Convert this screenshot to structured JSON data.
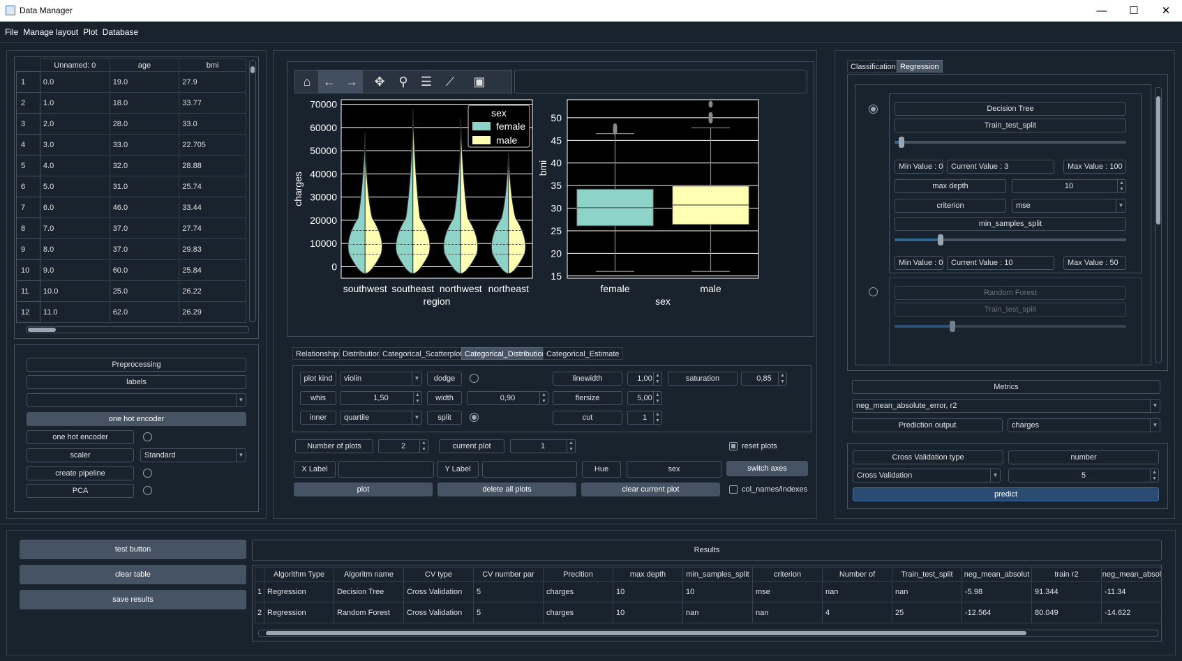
{
  "window": {
    "title": "Data Manager",
    "min": "—",
    "max": "☐",
    "close": "✕"
  },
  "menu": [
    "File",
    "Manage layout",
    "Plot",
    "Database"
  ],
  "data_table": {
    "columns": [
      "Unnamed: 0",
      "age",
      "bmi"
    ],
    "rows": [
      [
        "1",
        "0.0",
        "19.0",
        "27.9"
      ],
      [
        "2",
        "1.0",
        "18.0",
        "33.77"
      ],
      [
        "3",
        "2.0",
        "28.0",
        "33.0"
      ],
      [
        "4",
        "3.0",
        "33.0",
        "22.705"
      ],
      [
        "5",
        "4.0",
        "32.0",
        "28.88"
      ],
      [
        "6",
        "5.0",
        "31.0",
        "25.74"
      ],
      [
        "7",
        "6.0",
        "46.0",
        "33.44"
      ],
      [
        "8",
        "7.0",
        "37.0",
        "27.74"
      ],
      [
        "9",
        "8.0",
        "37.0",
        "29.83"
      ],
      [
        "10",
        "9.0",
        "60.0",
        "25.84"
      ],
      [
        "11",
        "10.0",
        "25.0",
        "26.22"
      ],
      [
        "12",
        "11.0",
        "62.0",
        "26.29"
      ]
    ]
  },
  "preprocessing": {
    "title": "Preprocessing",
    "labels": "labels",
    "combo_value": "",
    "ohe_button": "one hot encoder",
    "ohe_label": "one hot encoder",
    "scaler_label": "scaler",
    "scaler_value": "Standard",
    "pipeline_label": "create pipeline",
    "pca_label": "PCA"
  },
  "toolbar": {
    "icons": [
      "home-icon",
      "back-icon",
      "forward-icon",
      "pan-icon",
      "zoom-icon",
      "configure-icon",
      "edit-axes-icon",
      "save-icon"
    ],
    "coords": ""
  },
  "chart_data": [
    {
      "type": "violin",
      "x_categories": [
        "southwest",
        "southeast",
        "northwest",
        "northeast"
      ],
      "xlabel": "region",
      "ylabel": "charges",
      "yticks": [
        0,
        10000,
        20000,
        30000,
        40000,
        50000,
        60000,
        70000
      ],
      "ylim": [
        -5000,
        72000
      ],
      "legend": {
        "title": "sex",
        "entries": [
          "female",
          "male"
        ],
        "placement": "top-right"
      },
      "series": [
        {
          "name": "female",
          "color": "#8dd3c7",
          "max": [
            58000,
            62000,
            56000,
            49000
          ]
        },
        {
          "name": "male",
          "color": "#ffffb3",
          "max": [
            52000,
            68000,
            64000,
            49000
          ]
        }
      ],
      "inner": "quartile",
      "split": true,
      "grid": true
    },
    {
      "type": "box",
      "categories": [
        "female",
        "male"
      ],
      "xlabel": "sex",
      "ylabel": "bmi",
      "yticks": [
        15,
        20,
        25,
        30,
        35,
        40,
        45,
        50
      ],
      "ylim": [
        14.5,
        54
      ],
      "boxes": [
        {
          "name": "female",
          "color": "#8dd3c7",
          "min": 16,
          "q1": 26.1,
          "median": 30.1,
          "q3": 34.2,
          "max": 46.5,
          "outliers": [
            47,
            47.5,
            48
          ]
        },
        {
          "name": "male",
          "color": "#ffffb3",
          "min": 16,
          "q1": 26.4,
          "median": 30.7,
          "q3": 34.9,
          "max": 47.8,
          "outliers": [
            49.5,
            50.5,
            53
          ]
        }
      ],
      "grid": true
    }
  ],
  "plot_tabs": [
    "Relationships",
    "Distribution",
    "Categorical_Scatterplots",
    "Categorical_Distribution",
    "Categorical_Estimate"
  ],
  "plot_opts": {
    "plot_kind_l": "plot kind",
    "plot_kind": "violin",
    "dodge": "dodge",
    "linewidth_l": "linewidth",
    "linewidth": "1,00",
    "saturation_l": "saturation",
    "saturation": "0,85",
    "whis_l": "whis",
    "whis": "1,50",
    "width_l": "width",
    "width": "0,90",
    "fliersize_l": "flersize",
    "fliersize": "5,00",
    "inner_l": "inner",
    "inner": "quartile",
    "split": "split",
    "cut_l": "cut",
    "cut": "1"
  },
  "plot_ctrl": {
    "num_plots_l": "Number of plots",
    "num_plots": "2",
    "cur_plot_l": "current plot",
    "cur_plot": "1",
    "reset": "reset plots",
    "xlabel_l": "X Label",
    "xlabel": "",
    "ylabel_l": "Y Label",
    "ylabel": "",
    "hue_l": "Hue",
    "hue": "sex",
    "switch": "switch axes",
    "plot": "plot",
    "delete": "delete all plots",
    "clear": "clear current plot",
    "colnames": "col_names/indexes"
  },
  "model_tabs": [
    "Classification",
    "Regression"
  ],
  "dt": {
    "title": "Decision Tree",
    "tts": "Train_test_split",
    "min1": "Min Value : 0",
    "cur1": "Current Value : 3",
    "max1": "Max Value : 100",
    "level1": 0.03,
    "maxdepth_l": "max depth",
    "maxdepth": "10",
    "criterion_l": "criterion",
    "criterion": "mse",
    "mss": "min_samples_split",
    "min2": "Min Value : 0",
    "cur2": "Current Value : 10",
    "max2": "Max Value : 50",
    "level2": 0.2
  },
  "rf": {
    "title": "Random Forest",
    "tts": "Train_test_split",
    "level": 0.25
  },
  "metrics": {
    "title": "Metrics",
    "value": "neg_mean_absolute_error, r2",
    "pred_l": "Prediction output",
    "pred": "charges"
  },
  "cv": {
    "type_l": "Cross Validation type",
    "number_l": "number",
    "type": "Cross Validation",
    "number": "5",
    "predict": "predict"
  },
  "bottom_buttons": {
    "test": "test button",
    "clear": "clear table",
    "save": "save results"
  },
  "results": {
    "title": "Results",
    "columns": [
      "Algorithm Type",
      "Algoritm name",
      "CV type",
      "CV number par",
      "Precition",
      "max depth",
      "min_samples_split",
      "criterion",
      "Number of",
      "Train_test_split",
      "neg_mean_absolut",
      "train r2",
      "neg_mean_absol"
    ],
    "rows": [
      [
        "1",
        "Regression",
        "Decision Tree",
        "Cross Validation",
        "5",
        "charges",
        "10",
        "10",
        "mse",
        "nan",
        "nan",
        "-5.98",
        "91.344",
        "-11.34"
      ],
      [
        "2",
        "Regression",
        "Random Forest",
        "Cross Validation",
        "5",
        "charges",
        "10",
        "nan",
        "nan",
        "4",
        "25",
        "-12.564",
        "80.049",
        "-14.622"
      ]
    ]
  }
}
